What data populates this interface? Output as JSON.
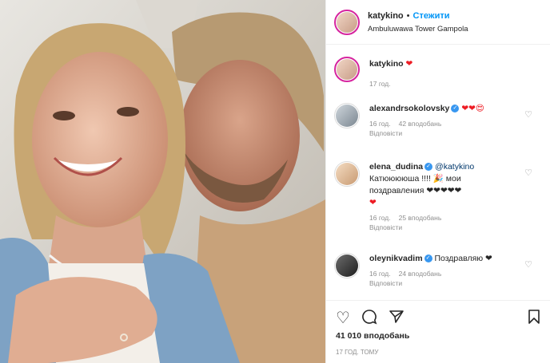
{
  "header": {
    "username": "katykino",
    "separator": "•",
    "follow_label": "Стежити",
    "location": "Ambuluwawa Tower Gampola"
  },
  "caption": {
    "username": "katykino",
    "text": "❤",
    "time": "17 год."
  },
  "comments": [
    {
      "username": "alexandrsokolovsky",
      "verified": true,
      "text": "❤❤😍",
      "time": "16 год.",
      "likes": "42 вподобань",
      "reply": "Відповісти"
    },
    {
      "username": "elena_dudina",
      "verified": true,
      "mention": "@katykino",
      "line2": "Катююююша !!!! 🎉 мои",
      "line3": "поздравления ❤❤❤❤❤",
      "line4": "❤",
      "time": "16 год.",
      "likes": "25 вподобань",
      "reply": "Відповісти"
    },
    {
      "username": "oleynikvadim",
      "verified": true,
      "text": "Поздравляю ❤",
      "time": "16 год.",
      "likes": "24 вподобань",
      "reply": "Відповісти"
    }
  ],
  "footer": {
    "likes": "41 010 вподобань",
    "time_ago": "17 ГОД. ТОМУ"
  },
  "icons": {
    "like": "heart-outline-icon",
    "comment": "comment-bubble-icon",
    "share": "paper-plane-icon",
    "save": "bookmark-icon",
    "verified": "verified-badge-icon"
  },
  "colors": {
    "accent": "#0095f6",
    "heart": "#ed1c24",
    "muted": "#8e8e8e",
    "verified": "#3897f0"
  }
}
